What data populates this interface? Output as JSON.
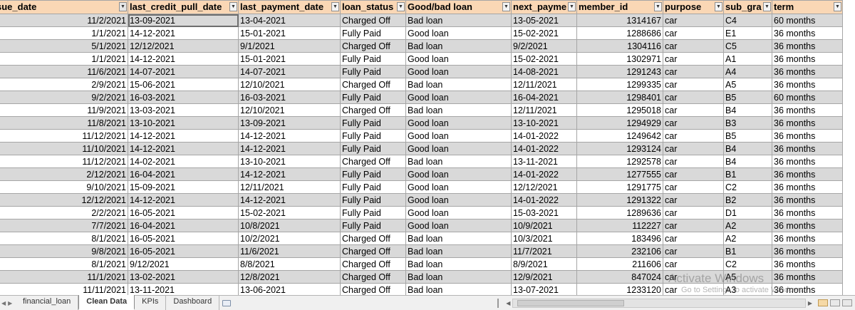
{
  "columns": [
    {
      "label": "sue_date",
      "filter": "active",
      "align": "right"
    },
    {
      "label": "last_credit_pull_date",
      "filter": "normal",
      "align": "left"
    },
    {
      "label": "last_payment_date",
      "filter": "normal",
      "align": "left"
    },
    {
      "label": "loan_status",
      "filter": "normal",
      "align": "left"
    },
    {
      "label": "Good/bad loan",
      "filter": "normal",
      "align": "left"
    },
    {
      "label": "next_payme",
      "filter": "normal",
      "align": "left"
    },
    {
      "label": "member_id",
      "filter": "normal",
      "align": "right"
    },
    {
      "label": "purpose",
      "filter": "normal",
      "align": "left"
    },
    {
      "label": "sub_gra",
      "filter": "normal",
      "align": "left"
    },
    {
      "label": "term",
      "filter": "normal",
      "align": "left"
    }
  ],
  "rows": [
    [
      "11/2/2021",
      "13-09-2021",
      "13-04-2021",
      "Charged Off",
      "Bad loan",
      "13-05-2021",
      "1314167",
      "car",
      "C4",
      "60 months"
    ],
    [
      "1/1/2021",
      "14-12-2021",
      "15-01-2021",
      "Fully Paid",
      "Good loan",
      "15-02-2021",
      "1288686",
      "car",
      "E1",
      "36 months"
    ],
    [
      "5/1/2021",
      "12/12/2021",
      "9/1/2021",
      "Charged Off",
      "Bad loan",
      "9/2/2021",
      "1304116",
      "car",
      "C5",
      "36 months"
    ],
    [
      "1/1/2021",
      "14-12-2021",
      "15-01-2021",
      "Fully Paid",
      "Good loan",
      "15-02-2021",
      "1302971",
      "car",
      "A1",
      "36 months"
    ],
    [
      "11/6/2021",
      "14-07-2021",
      "14-07-2021",
      "Fully Paid",
      "Good loan",
      "14-08-2021",
      "1291243",
      "car",
      "A4",
      "36 months"
    ],
    [
      "2/9/2021",
      "15-06-2021",
      "12/10/2021",
      "Charged Off",
      "Bad loan",
      "12/11/2021",
      "1299335",
      "car",
      "A5",
      "36 months"
    ],
    [
      "9/2/2021",
      "16-03-2021",
      "16-03-2021",
      "Fully Paid",
      "Good loan",
      "16-04-2021",
      "1298401",
      "car",
      "B5",
      "60 months"
    ],
    [
      "11/9/2021",
      "13-03-2021",
      "12/10/2021",
      "Charged Off",
      "Bad loan",
      "12/11/2021",
      "1295018",
      "car",
      "B4",
      "36 months"
    ],
    [
      "11/8/2021",
      "13-10-2021",
      "13-09-2021",
      "Fully Paid",
      "Good loan",
      "13-10-2021",
      "1294929",
      "car",
      "B3",
      "36 months"
    ],
    [
      "11/12/2021",
      "14-12-2021",
      "14-12-2021",
      "Fully Paid",
      "Good loan",
      "14-01-2022",
      "1249642",
      "car",
      "B5",
      "36 months"
    ],
    [
      "11/10/2021",
      "14-12-2021",
      "14-12-2021",
      "Fully Paid",
      "Good loan",
      "14-01-2022",
      "1293124",
      "car",
      "B4",
      "36 months"
    ],
    [
      "11/12/2021",
      "14-02-2021",
      "13-10-2021",
      "Charged Off",
      "Bad loan",
      "13-11-2021",
      "1292578",
      "car",
      "B4",
      "36 months"
    ],
    [
      "2/12/2021",
      "16-04-2021",
      "14-12-2021",
      "Fully Paid",
      "Good loan",
      "14-01-2022",
      "1277555",
      "car",
      "B1",
      "36 months"
    ],
    [
      "9/10/2021",
      "15-09-2021",
      "12/11/2021",
      "Fully Paid",
      "Good loan",
      "12/12/2021",
      "1291775",
      "car",
      "C2",
      "36 months"
    ],
    [
      "12/12/2021",
      "14-12-2021",
      "14-12-2021",
      "Fully Paid",
      "Good loan",
      "14-01-2022",
      "1291322",
      "car",
      "B2",
      "36 months"
    ],
    [
      "2/2/2021",
      "16-05-2021",
      "15-02-2021",
      "Fully Paid",
      "Good loan",
      "15-03-2021",
      "1289636",
      "car",
      "D1",
      "36 months"
    ],
    [
      "7/7/2021",
      "16-04-2021",
      "10/8/2021",
      "Fully Paid",
      "Good loan",
      "10/9/2021",
      "112227",
      "car",
      "A2",
      "36 months"
    ],
    [
      "8/1/2021",
      "16-05-2021",
      "10/2/2021",
      "Charged Off",
      "Bad loan",
      "10/3/2021",
      "183496",
      "car",
      "A2",
      "36 months"
    ],
    [
      "9/8/2021",
      "16-05-2021",
      "11/6/2021",
      "Charged Off",
      "Bad loan",
      "11/7/2021",
      "232106",
      "car",
      "B1",
      "36 months"
    ],
    [
      "8/1/2021",
      "9/12/2021",
      "8/8/2021",
      "Charged Off",
      "Bad loan",
      "8/9/2021",
      "211606",
      "car",
      "C2",
      "36 months"
    ],
    [
      "11/1/2021",
      "13-02-2021",
      "12/8/2021",
      "Charged Off",
      "Bad loan",
      "12/9/2021",
      "847024",
      "car",
      "A5",
      "36 months"
    ],
    [
      "11/11/2021",
      "13-11-2021",
      "13-06-2021",
      "Charged Off",
      "Bad loan",
      "13-07-2021",
      "1233120",
      "car",
      "A3",
      "36 months"
    ]
  ],
  "sheet_tabs": [
    {
      "label": "financial_loan",
      "active": false
    },
    {
      "label": "Clean Data",
      "active": true
    },
    {
      "label": "KPIs",
      "active": false
    },
    {
      "label": "Dashboard",
      "active": false
    }
  ],
  "watermark": {
    "title": "Activate Windows",
    "subtitle": "Go to Settings to activate Windows."
  },
  "colors": {
    "header_bg": "#fad7b5",
    "band_gray": "#d9d9d9",
    "band_white": "#ffffff"
  }
}
